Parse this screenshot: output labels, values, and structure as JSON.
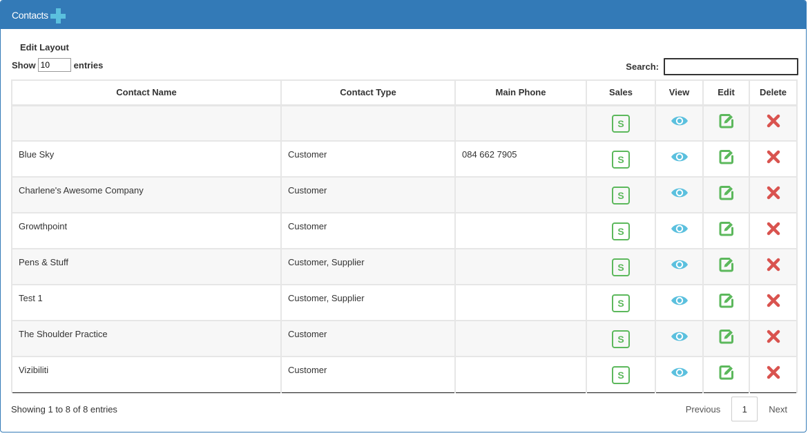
{
  "panel": {
    "title": "Contacts"
  },
  "edit_layout": "Edit Layout",
  "length": {
    "prefix": "Show",
    "value": "10",
    "suffix": "entries"
  },
  "search": {
    "label": "Search:",
    "value": ""
  },
  "columns": [
    "Contact Name",
    "Contact Type",
    "Main Phone",
    "Sales",
    "View",
    "Edit",
    "Delete"
  ],
  "rows": [
    {
      "name": "",
      "type": "",
      "phone": ""
    },
    {
      "name": "Blue Sky",
      "type": "Customer",
      "phone": "084 662 7905"
    },
    {
      "name": "Charlene's Awesome Company",
      "type": "Customer",
      "phone": ""
    },
    {
      "name": "Growthpoint",
      "type": "Customer",
      "phone": ""
    },
    {
      "name": "Pens & Stuff",
      "type": "Customer, Supplier",
      "phone": ""
    },
    {
      "name": "Test 1",
      "type": "Customer, Supplier",
      "phone": ""
    },
    {
      "name": "The Shoulder Practice",
      "type": "Customer",
      "phone": ""
    },
    {
      "name": "Vizibiliti",
      "type": "Customer",
      "phone": ""
    }
  ],
  "row_icons": {
    "sales": "S",
    "view": "eye-icon",
    "edit": "edit-icon",
    "delete": "delete-icon"
  },
  "info": "Showing 1 to 8 of 8 entries",
  "pagination": {
    "previous": "Previous",
    "current_page": "1",
    "next": "Next"
  },
  "colors": {
    "header_bg": "#337ab7",
    "plus_icon": "#5bc0de",
    "sales_green": "#5cb85c",
    "view_blue": "#5bc0de",
    "delete_red": "#d9534f"
  }
}
